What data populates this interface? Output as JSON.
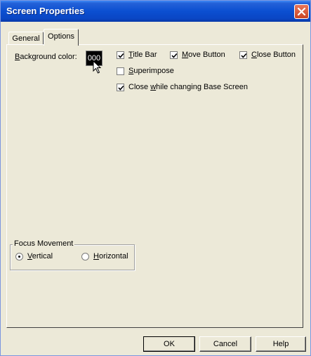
{
  "window": {
    "title": "Screen Properties"
  },
  "tabs": [
    {
      "label": "General",
      "active": false
    },
    {
      "label": "Options",
      "active": true
    }
  ],
  "options": {
    "background_color_label": "Background color:",
    "background_color_value": "000",
    "checkboxes": [
      {
        "id": "title_bar",
        "label": "Title Bar",
        "checked": true
      },
      {
        "id": "move_button",
        "label": "Move Button",
        "checked": true
      },
      {
        "id": "close_button",
        "label": "Close Button",
        "checked": true
      },
      {
        "id": "superimpose",
        "label": "Superimpose",
        "checked": false
      },
      {
        "id": "close_while_changing",
        "label": "Close while changing Base Screen",
        "checked": true
      }
    ]
  },
  "focus_movement": {
    "legend": "Focus Movement",
    "options": [
      {
        "label": "Vertical",
        "selected": true
      },
      {
        "label": "Horizontal",
        "selected": false
      }
    ]
  },
  "buttons": {
    "ok": "OK",
    "cancel": "Cancel",
    "help": "Help"
  }
}
